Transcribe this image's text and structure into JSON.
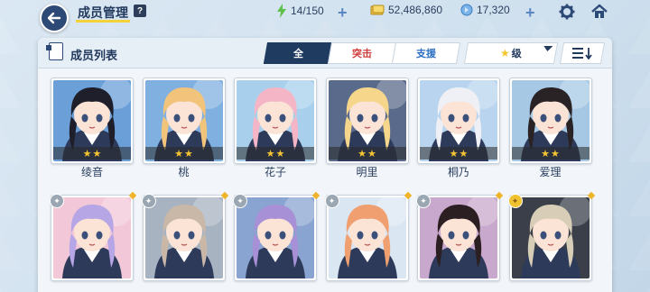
{
  "header": {
    "title": "成员管理",
    "help_label": "?",
    "ap": "14/150",
    "credits": "52,486,860",
    "gems": "17,320"
  },
  "panel": {
    "title": "成员列表",
    "tabs": [
      "全",
      "突击",
      "支援"
    ],
    "sort_label": "级",
    "order_icon": "sort-descending-icon"
  },
  "students_row1": [
    {
      "name": "绫音",
      "stars": 2,
      "hair": "#1f1f2b",
      "bg": "#6a9fd8"
    },
    {
      "name": "桃",
      "stars": 2,
      "hair": "#f2c37a",
      "bg": "#7fb0e0"
    },
    {
      "name": "花子",
      "stars": 2,
      "hair": "#f4b6c6",
      "bg": "#a8d0ec"
    },
    {
      "name": "明里",
      "stars": 2,
      "hair": "#f5d68a",
      "bg": "#5a6a8a"
    },
    {
      "name": "桐乃",
      "stars": 2,
      "hair": "#eef0f6",
      "bg": "#b8d4ee"
    },
    {
      "name": "爱理",
      "stars": 2,
      "hair": "#2a2326",
      "bg": "#a6c8e4"
    }
  ],
  "students_row2": [
    {
      "hair": "#b7a6e6",
      "bg": "#f2c7d8",
      "pin": "gray"
    },
    {
      "hair": "#c9b8a8",
      "bg": "#a7b3c0",
      "pin": "gray"
    },
    {
      "hair": "#a890d6",
      "bg": "#8aa4d2",
      "pin": "gray"
    },
    {
      "hair": "#f0a070",
      "bg": "#dbe6f3",
      "pin": "gray"
    },
    {
      "hair": "#2c1f22",
      "bg": "#c8a8cc",
      "pin": "gray"
    },
    {
      "hair": "#d8cdb6",
      "bg": "#3a3f4a",
      "pin": "gold"
    }
  ],
  "colors": {
    "navy": "#1f3b60",
    "strike": "#d03a3a",
    "support": "#2b6fc2",
    "star": "#f5c531"
  }
}
